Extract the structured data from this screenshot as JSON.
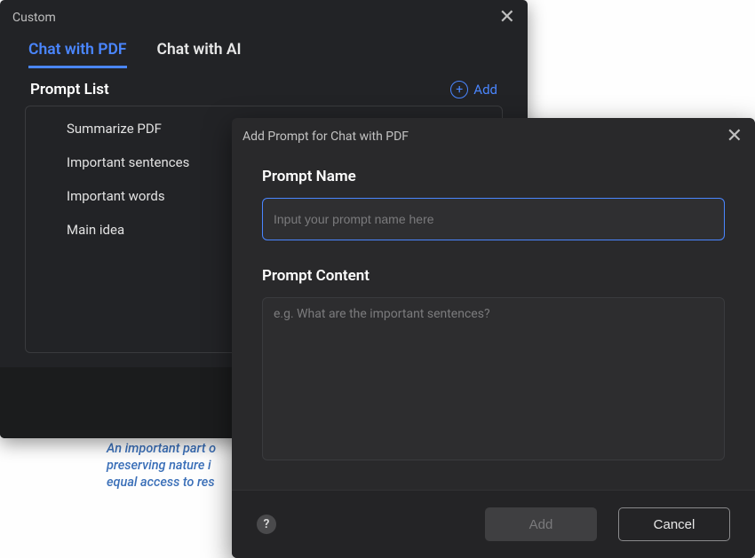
{
  "background": {
    "italic_text": "An important part o\npreserving nature i\nequal access to res"
  },
  "custom_panel": {
    "title": "Custom",
    "tabs": {
      "pdf": "Chat with PDF",
      "ai": "Chat with AI"
    },
    "list_header": "Prompt List",
    "add_label": "Add",
    "items": [
      "Summarize PDF",
      "Important sentences",
      "Important words",
      "Main idea"
    ]
  },
  "dialog": {
    "title": "Add Prompt for Chat with PDF",
    "name_label": "Prompt Name",
    "name_placeholder": "Input your prompt name here",
    "name_value": "",
    "content_label": "Prompt Content",
    "content_placeholder": "e.g. What are the important sentences?",
    "content_value": "",
    "add_button": "Add",
    "cancel_button": "Cancel"
  }
}
